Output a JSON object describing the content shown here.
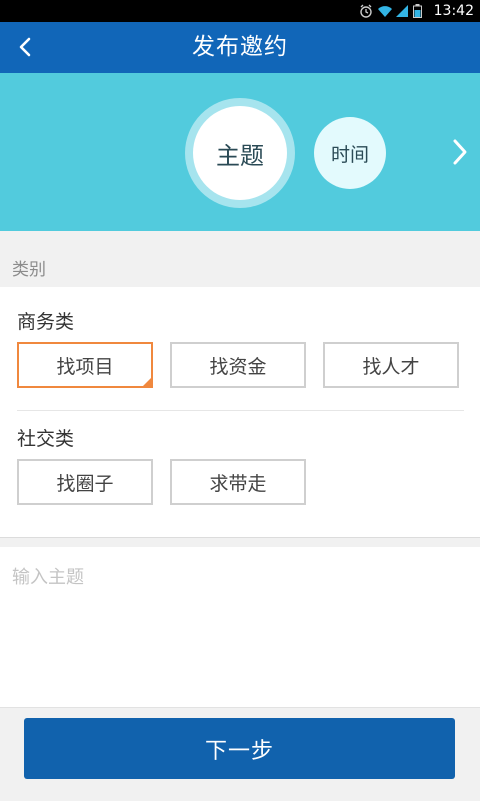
{
  "status_bar": {
    "time": "13:42",
    "icons": [
      "alarm-icon",
      "wifi-icon",
      "signal-icon",
      "battery-icon"
    ]
  },
  "header": {
    "title": "发布邀约",
    "back_icon": "chevron-left-icon"
  },
  "steps": {
    "current": "主题",
    "next": "时间",
    "arrow_icon": "chevron-right-icon"
  },
  "category": {
    "label": "类别",
    "groups": [
      {
        "title": "商务类",
        "options": [
          "找项目",
          "找资金",
          "找人才"
        ],
        "selected": "找项目"
      },
      {
        "title": "社交类",
        "options": [
          "找圈子",
          "求带走"
        ]
      }
    ]
  },
  "topic": {
    "placeholder": "输入主题",
    "value": ""
  },
  "footer": {
    "next_label": "下一步"
  },
  "colors": {
    "header": "#1166b8",
    "steps_band": "#52cbdd",
    "selected_border": "#f0883e",
    "primary_button": "#1162ad"
  }
}
